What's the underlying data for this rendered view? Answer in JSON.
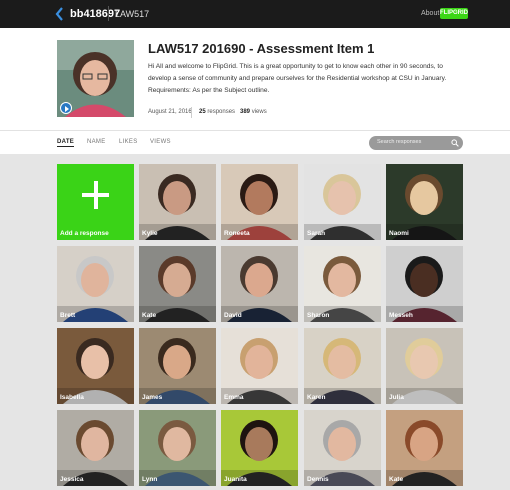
{
  "topbar": {
    "grid_id": "bb418697",
    "breadcrumb": "LAW517",
    "about_label": "About",
    "brand_label": "FLIPGRID"
  },
  "topic": {
    "title": "LAW517 201690 - Assessment Item 1",
    "description": "Hi All and welcome to FlipGrid.  This is a great opportunity to get to know each other in 90 seconds, to develop a sense of community and prepare ourselves for the Residential workshop at CSU in January. Requirements: As per the Subject outline.",
    "date": "August 21, 2016",
    "responses_count": "25",
    "responses_label": "responses",
    "views_count": "389",
    "views_label": "views"
  },
  "sort": {
    "tabs": [
      "DATE",
      "NAME",
      "LIKES",
      "VIEWS"
    ],
    "active": "DATE",
    "search_placeholder": "Search responses"
  },
  "add_response_label": "Add a response",
  "responses": [
    {
      "name": "Kylie",
      "bg": "#c9bfb3",
      "skin": "#c99a83",
      "hair": "#3a2a22",
      "shirt": "#2a2a2a"
    },
    {
      "name": "Roneeta",
      "bg": "#d8c9b8",
      "skin": "#b27a5e",
      "hair": "#2a1a14",
      "shirt": "#c0504a"
    },
    {
      "name": "Sarah",
      "bg": "#e3e3e3",
      "skin": "#e6c2ad",
      "hair": "#d9c69a",
      "shirt": "#3a3a3a"
    },
    {
      "name": "Naomi",
      "bg": "#2c3a2a",
      "skin": "#e6c8a0",
      "hair": "#6a4a2e",
      "shirt": "#1a1a1a"
    },
    {
      "name": "Brett",
      "bg": "#d6d0c8",
      "skin": "#e0b49c",
      "hair": "#c8c8c8",
      "shirt": "#2b4f8f"
    },
    {
      "name": "Kate",
      "bg": "#8a8a86",
      "skin": "#d6ab92",
      "hair": "#5a3a2a",
      "shirt": "#2a2a2a"
    },
    {
      "name": "David",
      "bg": "#bcb6ae",
      "skin": "#dba88e",
      "hair": "#4a3a30",
      "shirt": "#1e2a40"
    },
    {
      "name": "Sharon",
      "bg": "#e8e6e0",
      "skin": "#e3b8a0",
      "hair": "#7a5a3c",
      "shirt": "#555555"
    },
    {
      "name": "Messeh",
      "bg": "#cfcfcf",
      "skin": "#4a2e22",
      "hair": "#1a1a1a",
      "shirt": "#6a2c3a"
    },
    {
      "name": "Isabella",
      "bg": "#7a5a3c",
      "skin": "#e8c0a8",
      "hair": "#3a2a20",
      "shirt": "#d8d8d8"
    },
    {
      "name": "James",
      "bg": "#9c8a72",
      "skin": "#d9a888",
      "hair": "#3a2a1e",
      "shirt": "#3d5a80"
    },
    {
      "name": "Emma",
      "bg": "#e6e0d8",
      "skin": "#e2b49a",
      "hair": "#c8a070",
      "shirt": "#444444"
    },
    {
      "name": "Karen",
      "bg": "#d8d2c6",
      "skin": "#e4bca2",
      "hair": "#d6b878",
      "shirt": "#3a3a4a"
    },
    {
      "name": "Julia",
      "bg": "#c8c2b8",
      "skin": "#e8c8b0",
      "hair": "#e0cc9a",
      "shirt": "#e8e8e8"
    },
    {
      "name": "Jessica",
      "bg": "#b0aca4",
      "skin": "#e0b6a0",
      "hair": "#6a4a30",
      "shirt": "#2a2a2a"
    },
    {
      "name": "Lynn",
      "bg": "#8a9a7a",
      "skin": "#e0b8a0",
      "hair": "#7a5a40",
      "shirt": "#4a6a8a"
    },
    {
      "name": "Juanita",
      "bg": "#a8c838",
      "skin": "#a87a5c",
      "hair": "#1e1410",
      "shirt": "#2a2a2a"
    },
    {
      "name": "Dennis",
      "bg": "#d8d4cc",
      "skin": "#e2b8a0",
      "hair": "#a8a8a8",
      "shirt": "#5a5a6a"
    },
    {
      "name": "Kate",
      "bg": "#c4a080",
      "skin": "#d8a484",
      "hair": "#8a4a2a",
      "shirt": "#2a2a2a"
    }
  ]
}
